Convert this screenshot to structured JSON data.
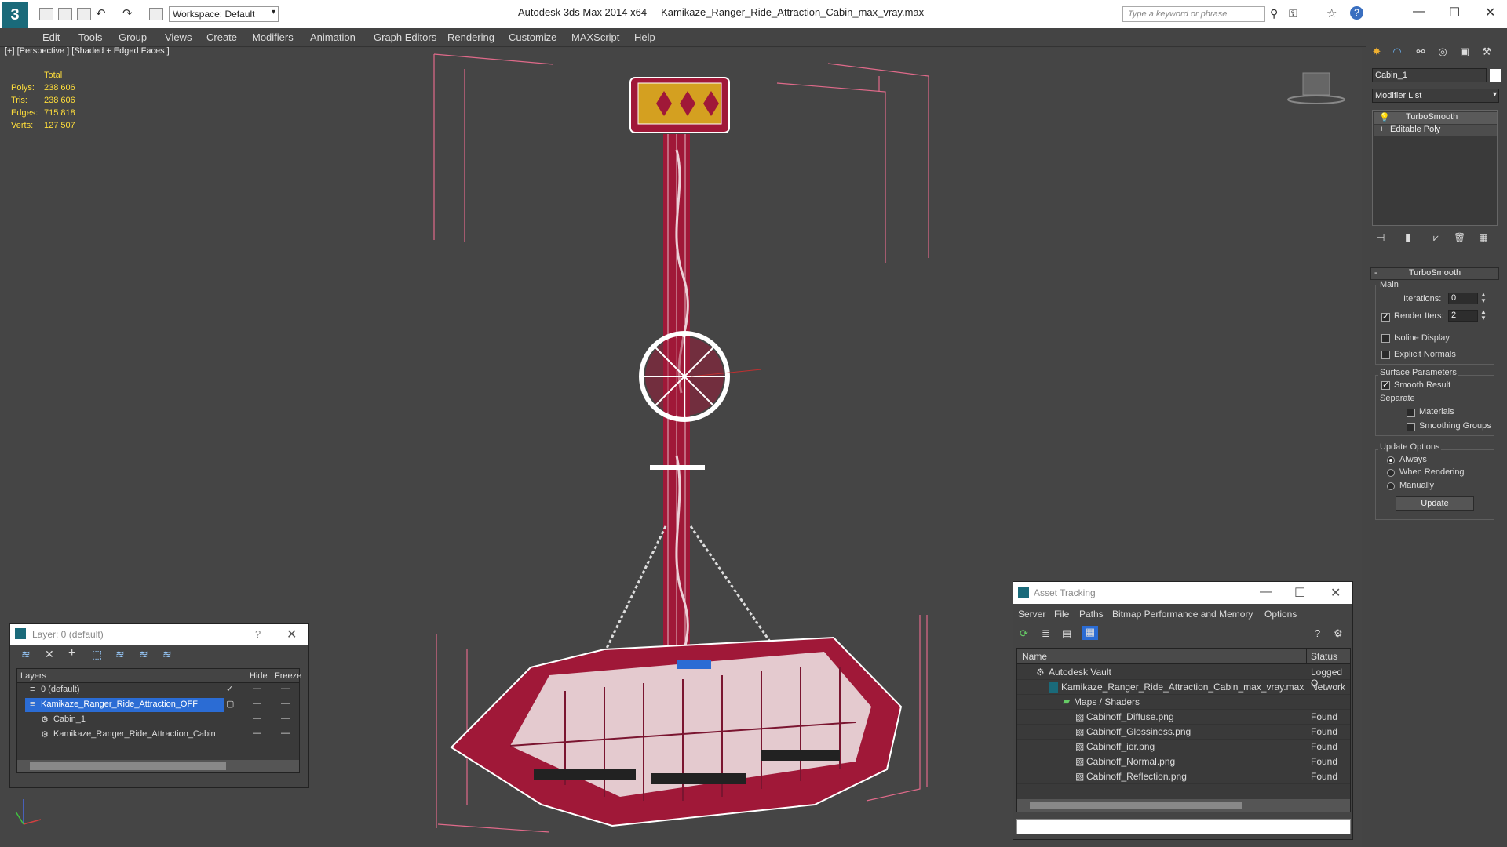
{
  "window": {
    "app": "Autodesk 3ds Max  2014 x64",
    "file": "Kamikaze_Ranger_Ride_Attraction_Cabin_max_vray.max",
    "workspace": "Workspace: Default",
    "search_placeholder": "Type a keyword or phrase"
  },
  "menu": [
    "Edit",
    "Tools",
    "Group",
    "Views",
    "Create",
    "Modifiers",
    "Animation",
    "Graph Editors",
    "Rendering",
    "Customize",
    "MAXScript",
    "Help"
  ],
  "viewport": {
    "label": "[+] [Perspective ] [Shaded + Edged Faces ]",
    "stats": {
      "header": "Total",
      "rows": [
        {
          "label": "Polys:",
          "value": "238 606"
        },
        {
          "label": "Tris:",
          "value": "238 606"
        },
        {
          "label": "Edges:",
          "value": "715 818"
        },
        {
          "label": "Verts:",
          "value": "127 507"
        }
      ]
    }
  },
  "command_panel": {
    "object_name": "Cabin_1",
    "modifier_list": "Modifier List",
    "stack": [
      "TurboSmooth",
      "Editable Poly"
    ],
    "rollout": "TurboSmooth",
    "main": {
      "title": "Main",
      "iterations_label": "Iterations:",
      "iterations": "0",
      "render_iters_label": "Render Iters:",
      "render_iters": "2",
      "isoline": "Isoline Display",
      "explicit": "Explicit Normals"
    },
    "surface": {
      "title": "Surface Parameters",
      "smooth": "Smooth Result",
      "separate": "Separate",
      "materials": "Materials",
      "smoothing_groups": "Smoothing Groups"
    },
    "update": {
      "title": "Update Options",
      "always": "Always",
      "when_rendering": "When Rendering",
      "manually": "Manually",
      "button": "Update"
    }
  },
  "layer_dialog": {
    "title": "Layer: 0 (default)",
    "help": "?",
    "col_layers": "Layers",
    "col_hide": "Hide",
    "col_freeze": "Freeze",
    "rows": [
      "0 (default)",
      "Kamikaze_Ranger_Ride_Attraction_OFF",
      "Cabin_1",
      "Kamikaze_Ranger_Ride_Attraction_Cabin"
    ]
  },
  "asset_dialog": {
    "title": "Asset Tracking",
    "menu": [
      "Server",
      "File",
      "Paths",
      "Bitmap Performance and Memory",
      "Options"
    ],
    "col_name": "Name",
    "col_status": "Status",
    "rows": [
      {
        "name": "Autodesk Vault",
        "status": "Logged O"
      },
      {
        "name": "Kamikaze_Ranger_Ride_Attraction_Cabin_max_vray.max",
        "status": "Network"
      },
      {
        "name": "Maps / Shaders",
        "status": ""
      },
      {
        "name": "Cabinoff_Diffuse.png",
        "status": "Found"
      },
      {
        "name": "Cabinoff_Glossiness.png",
        "status": "Found"
      },
      {
        "name": "Cabinoff_ior.png",
        "status": "Found"
      },
      {
        "name": "Cabinoff_Normal.png",
        "status": "Found"
      },
      {
        "name": "Cabinoff_Reflection.png",
        "status": "Found"
      }
    ]
  },
  "colors": {
    "accent": "#2b6cd4",
    "model_red": "#a01838",
    "stats_yellow": "#ffde3b",
    "bbox_pink": "#e06a8a"
  }
}
